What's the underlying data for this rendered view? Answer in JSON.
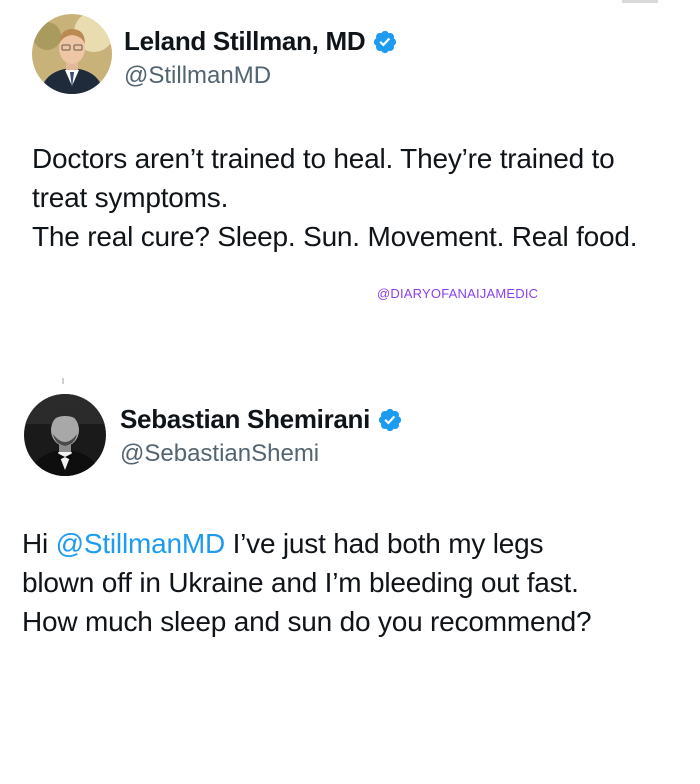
{
  "posts": [
    {
      "display_name": "Leland Stillman, MD",
      "handle": "@StillmanMD",
      "verified": true,
      "avatar_icon": "person-portrait-suit",
      "lines": [
        "Doctors aren’t trained to heal. They’re trained to",
        "treat symptoms.",
        "The real cure? Sleep. Sun. Movement. Real food."
      ]
    },
    {
      "display_name": "Sebastian Shemirani",
      "handle": "@SebastianShemi",
      "verified": true,
      "avatar_icon": "person-portrait-bowtie-bw",
      "reply_prefix": "Hi ",
      "mention": "@StillmanMD",
      "line1_rest": " I’ve just had both my legs",
      "lines_rest": [
        "blown off in Ukraine and I’m bleeding out fast.",
        "How much sleep and sun do you recommend?"
      ]
    }
  ],
  "watermark": "@DIARYOFANAIJAMEDIC",
  "colors": {
    "text": "#0f1419",
    "handle": "#536471",
    "mention": "#1d9bf0",
    "verified_badge": "#1d9bf0",
    "watermark": "#8a3ff0"
  }
}
